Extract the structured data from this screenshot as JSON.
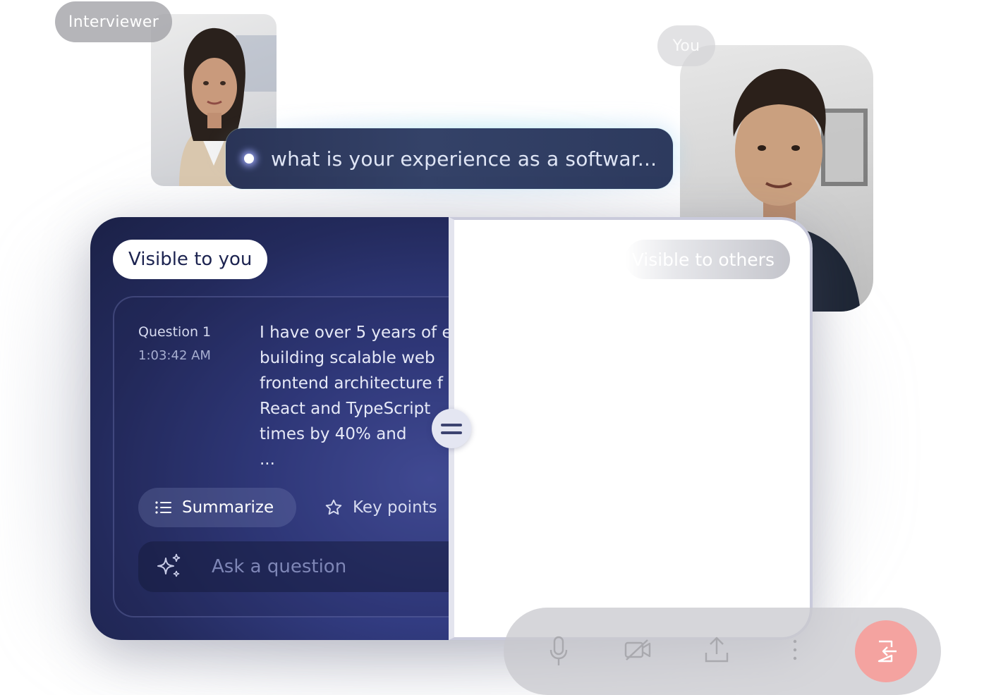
{
  "participants": {
    "interviewer_label": "Interviewer",
    "you_label": "You"
  },
  "live_question": {
    "text": "what is your experience as a softwar..."
  },
  "private_panel": {
    "badge": "Visible to you",
    "question_label": "Question 1",
    "question_time": "1:03:42 AM",
    "answer_lines": [
      "I have over 5 years of e",
      "building scalable web",
      "frontend architecture f",
      "React and TypeScript",
      "times by 40% and",
      "..."
    ],
    "summarize_label": "Summarize",
    "key_points_label": "Key points",
    "ask_placeholder": "Ask a question"
  },
  "shared_panel": {
    "badge": "Visible to others"
  },
  "icons": {
    "summarize": "list-icon",
    "key_points": "star-icon",
    "ask": "sparkles-icon",
    "mic": "microphone-icon",
    "camera": "video-off-icon",
    "share": "upload-icon",
    "more": "more-vertical-icon",
    "leave": "leave-call-icon"
  },
  "colors": {
    "panel_dark": "#232a5c",
    "accent_purple": "#4b56a8",
    "leave_button": "#f4a3a0"
  }
}
